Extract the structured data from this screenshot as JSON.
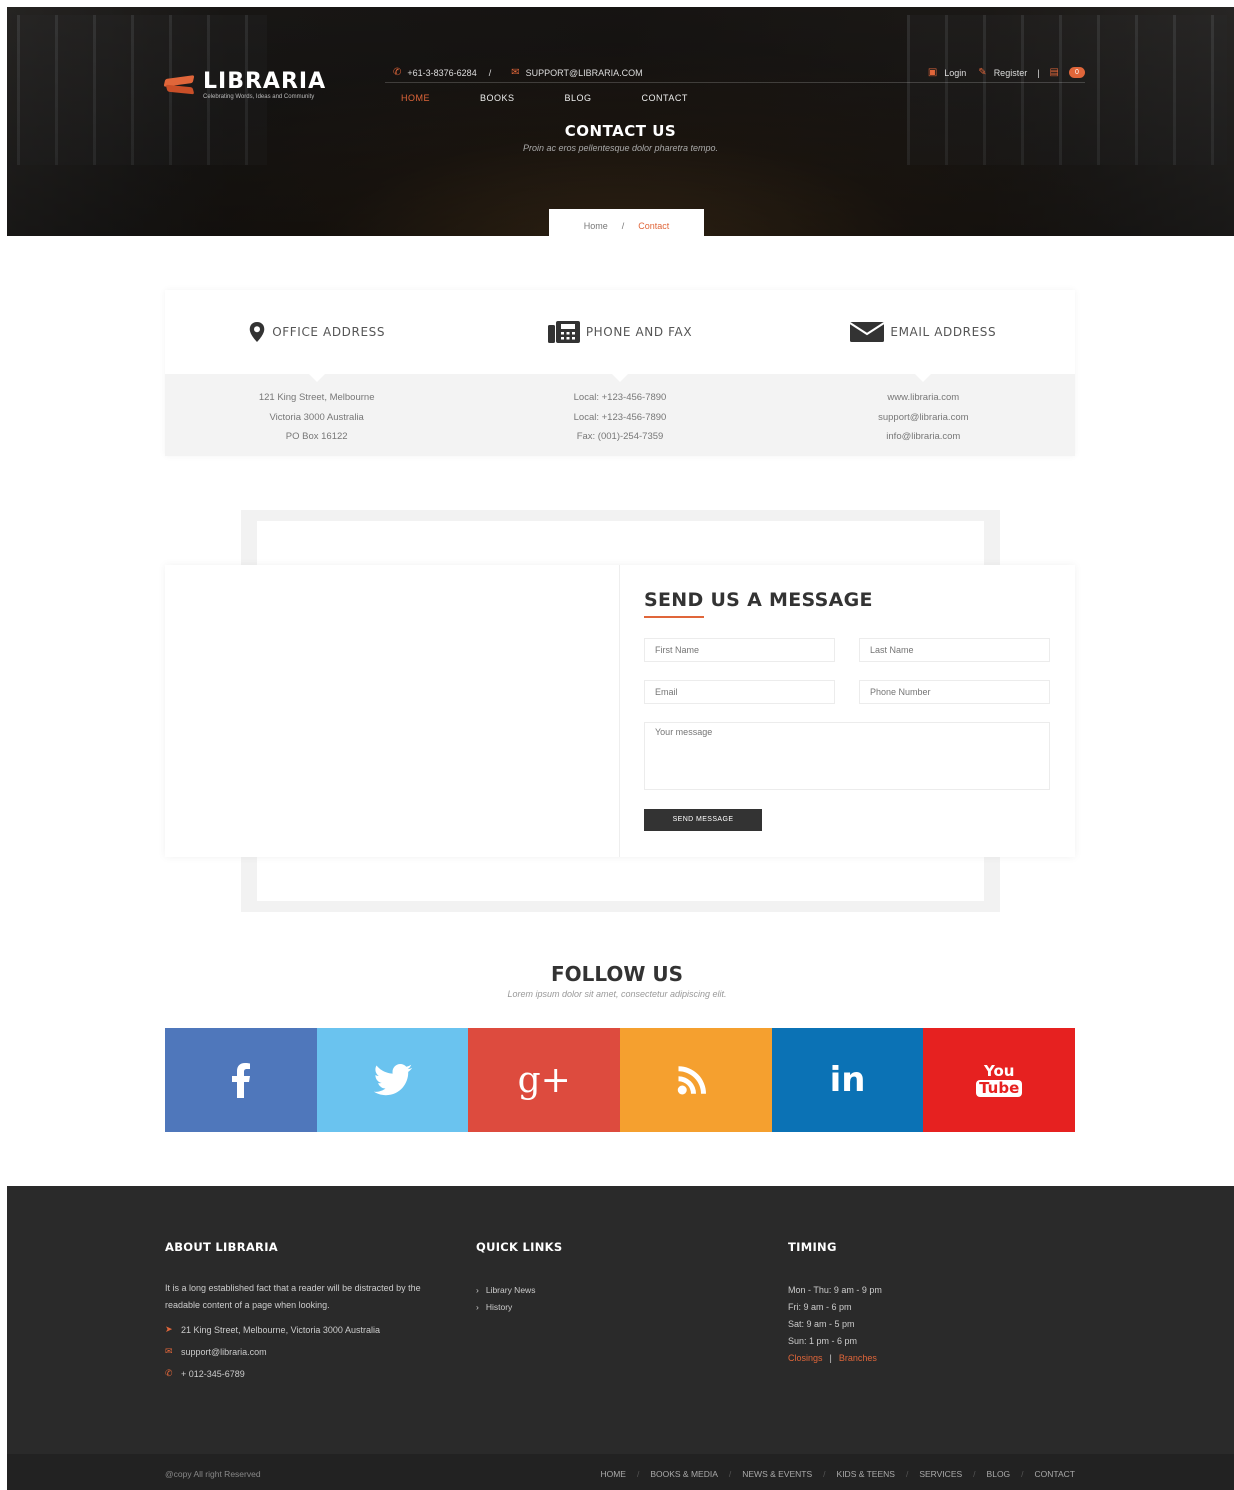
{
  "brand": {
    "name": "LIBRARIA",
    "tagline": "Celebrating Words, Ideas and Community"
  },
  "topbar": {
    "phone": "+61-3-8376-6284",
    "separator": "/",
    "email": "SUPPORT@LIBRARIA.COM",
    "login": "Login",
    "register": "Register",
    "pipe": "|",
    "cart_count": "0"
  },
  "nav": {
    "items": [
      "HOME",
      "BOOKS",
      "BLOG",
      "CONTACT"
    ],
    "active": "HOME"
  },
  "hero": {
    "title": "CONTACT US",
    "subtitle": "Proin ac eros pellentesque dolor pharetra tempo."
  },
  "breadcrumb": {
    "home": "Home",
    "separator": "/",
    "current": "Contact"
  },
  "contact_info": {
    "office": {
      "heading": "OFFICE ADDRESS",
      "lines": [
        "121 King Street, Melbourne",
        "Victoria 3000 Australia",
        "PO Box 16122"
      ]
    },
    "phone": {
      "heading": "PHONE AND FAX",
      "lines": [
        "Local: +123-456-7890",
        "Local: +123-456-7890",
        "Fax: (001)-254-7359"
      ]
    },
    "email": {
      "heading": "EMAIL ADDRESS",
      "lines": [
        "www.libraria.com",
        "support@libraria.com",
        "info@libraria.com"
      ]
    }
  },
  "message_form": {
    "title": "SEND US A MESSAGE",
    "first_name_placeholder": "First Name",
    "last_name_placeholder": "Last Name",
    "email_placeholder": "Email",
    "phone_placeholder": "Phone Number",
    "message_placeholder": "Your message",
    "submit_label": "SEND MESSAGE"
  },
  "follow": {
    "title": "FOLLOW US",
    "subtitle": "Lorem ipsum dolor sit amet, consectetur adipiscing elit.",
    "networks": [
      {
        "name": "facebook-icon",
        "color": "#4f77bb"
      },
      {
        "name": "twitter-icon",
        "color": "#6ac3ef"
      },
      {
        "name": "google-plus-icon",
        "color": "#dd4b3e"
      },
      {
        "name": "rss-icon",
        "color": "#f5a02f"
      },
      {
        "name": "linkedin-icon",
        "color": "#0b72b5"
      },
      {
        "name": "youtube-icon",
        "color": "#e62120"
      }
    ],
    "google_plus_glyph": "g+",
    "linkedin_glyph": "in",
    "youtube_glyph_top": "You",
    "youtube_glyph_bottom": "Tube"
  },
  "footer": {
    "about": {
      "heading": "ABOUT LIBRARIA",
      "text": "It is a long established fact that a reader will be distracted by the readable content of a page when looking.",
      "address": "21 King Street, Melbourne, Victoria 3000 Australia",
      "email": "support@libraria.com",
      "phone": "+ 012-345-6789"
    },
    "quick_links": {
      "heading": "QUICK LINKS",
      "items": [
        "Library News",
        "History"
      ]
    },
    "timing": {
      "heading": "TIMING",
      "items": [
        "Mon - Thu: 9 am - 9 pm",
        "Fri: 9 am - 6 pm",
        "Sat: 9 am - 5 pm",
        "Sun: 1 pm - 6 pm"
      ],
      "closings": "Closings",
      "pipe": "|",
      "branches": "Branches"
    }
  },
  "bottom": {
    "copyright": "@copy All right Reserved",
    "links": [
      "HOME",
      "BOOKS & MEDIA",
      "NEWS & EVENTS",
      "KIDS & TEENS",
      "SERVICES",
      "BLOG",
      "CONTACT"
    ],
    "separator": "/"
  },
  "colors": {
    "accent": "#e0663a",
    "footer_bg": "#2a2a2a",
    "bottom_bar": "#222222"
  }
}
